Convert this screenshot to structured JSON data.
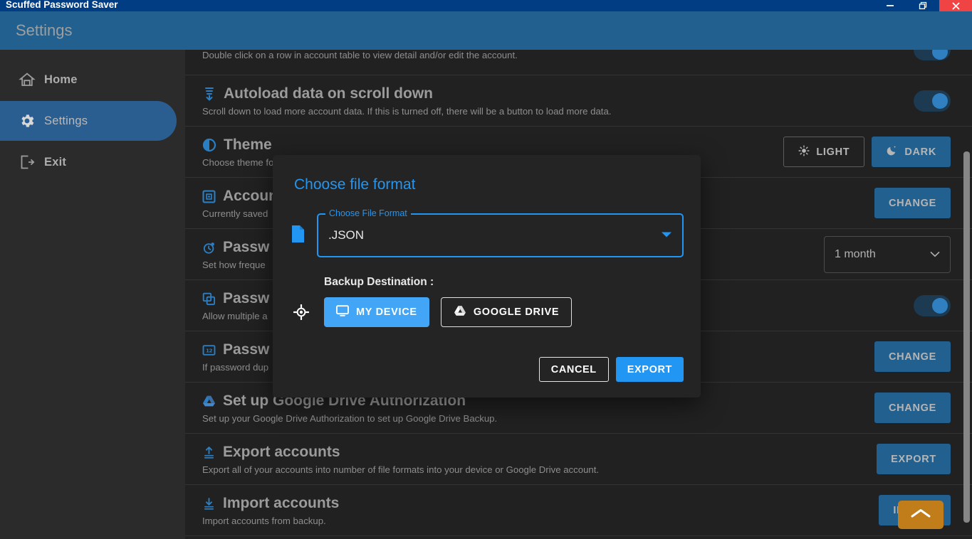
{
  "window": {
    "app_title": "Scuffed Password Saver",
    "controls": [
      {
        "name": "minimize",
        "icon": "minimize-icon"
      },
      {
        "name": "restore",
        "icon": "restore-icon"
      },
      {
        "name": "close",
        "icon": "close-icon"
      }
    ]
  },
  "header": {
    "title": "Settings"
  },
  "sidebar": {
    "items": [
      {
        "label": "Home",
        "icon": "home-icon",
        "active": false
      },
      {
        "label": "Settings",
        "icon": "gear-icon",
        "active": true
      },
      {
        "label": "Exit",
        "icon": "exit-icon",
        "active": false
      }
    ]
  },
  "settings": {
    "partial_row": {
      "desc": "Double click on a row in account table to view detail and/or edit the account."
    },
    "rows": [
      {
        "title": "Autoload data on scroll down",
        "desc": "Scroll down to load more account data. If this is turned off, there will be a button to load more data.",
        "icon": "autoload-icon",
        "control": "toggle",
        "toggle_on": true
      },
      {
        "title": "Theme",
        "desc": "Choose theme for the app. Light or Dark, whatever you like.",
        "icon": "theme-icon",
        "control": "theme-buttons",
        "light_label": "LIGHT",
        "dark_label": "DARK",
        "selected": "DARK"
      },
      {
        "title": "Account",
        "desc": "Currently saved",
        "icon": "account-icon",
        "control": "button",
        "button_label": "CHANGE"
      },
      {
        "title": "Passw",
        "desc": "Set how freque",
        "icon": "password-timer-icon",
        "control": "select",
        "select_value": "1 month"
      },
      {
        "title": "Passw",
        "desc": "Allow multiple a",
        "icon": "password-duplicate-icon",
        "control": "toggle",
        "toggle_on": true
      },
      {
        "title": "Passw",
        "desc": "If password dup",
        "icon": "password-count-icon",
        "control": "button",
        "button_label": "CHANGE"
      },
      {
        "title": "Set up Google Drive Authorization",
        "desc": "Set up your Google Drive Authorization to set up Google Drive Backup.",
        "icon": "google-drive-icon",
        "control": "button",
        "button_label": "CHANGE"
      },
      {
        "title": "Export accounts",
        "desc": "Export all of your accounts into number of file formats into your device or Google Drive account.",
        "icon": "export-icon",
        "control": "button",
        "button_label": "EXPORT"
      },
      {
        "title": "Import accounts",
        "desc": "Import accounts from backup.",
        "icon": "import-icon",
        "control": "button",
        "button_label": "IMPORT"
      }
    ]
  },
  "fab": {
    "icon": "scroll-to-top-icon"
  },
  "modal": {
    "title": "Choose file format",
    "file_format": {
      "legend": "Choose File Format",
      "value": ".JSON",
      "icon": "file-icon",
      "dropdown_icon": "chevron-down-icon"
    },
    "destination": {
      "label": "Backup Destination :",
      "icon": "target-icon",
      "options": [
        {
          "label": "MY DEVICE",
          "icon": "monitor-icon",
          "selected": true
        },
        {
          "label": "GOOGLE DRIVE",
          "icon": "google-drive-icon",
          "selected": false
        }
      ]
    },
    "actions": {
      "cancel_label": "CANCEL",
      "export_label": "EXPORT"
    }
  },
  "colors": {
    "titlebar": "#003d82",
    "header": "#22618f",
    "sidebar": "#2b2b2b",
    "content": "#212121",
    "accent": "#2196f3",
    "button": "#22618f",
    "close": "#f04343",
    "fab": "#c07d1a"
  }
}
